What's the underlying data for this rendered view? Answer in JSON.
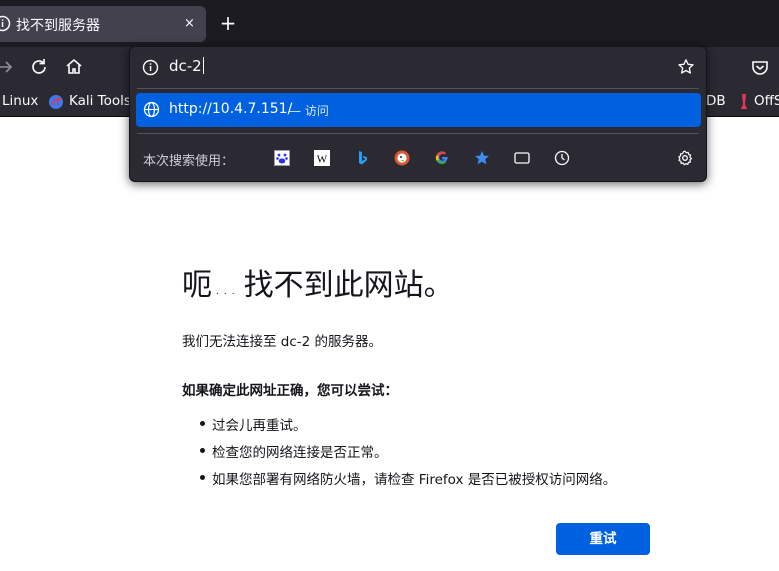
{
  "tab": {
    "title": "找不到服务器",
    "close": "×"
  },
  "newtab": "+",
  "bookmarks": [
    {
      "label": "Linux"
    },
    {
      "label": "Kali Tools"
    },
    {
      "label": "DB"
    },
    {
      "label": "OffS"
    }
  ],
  "urlbar": {
    "value": "dc-2",
    "suggestion_url": "http://10.4.7.151/",
    "suggestion_action": "— 访问",
    "search_label": "本次搜索使用：",
    "engine_icons": [
      "baidu-icon",
      "wikipedia-icon",
      "bing-icon",
      "duckduckgo-icon",
      "google-icon",
      "bookmarks-star-icon",
      "tabs-icon",
      "history-icon",
      "settings-gear-icon"
    ]
  },
  "error": {
    "title_a": "呃",
    "title_dots": "...",
    "title_b": "找不到此网站。",
    "description": "我们无法连接至 dc-2 的服务器。",
    "suggestions_title": "如果确定此网址正确，您可以尝试：",
    "suggestions": [
      "过会儿再重试。",
      "检查您的网络连接是否正常。",
      "如果您部署有网络防火墙，请检查 Firefox 是否已被授权访问网络。"
    ],
    "retry_label": "重试"
  },
  "colors": {
    "accent": "#0061e0",
    "chrome_dark": "#1c1b22",
    "toolbar": "#2b2a33"
  }
}
